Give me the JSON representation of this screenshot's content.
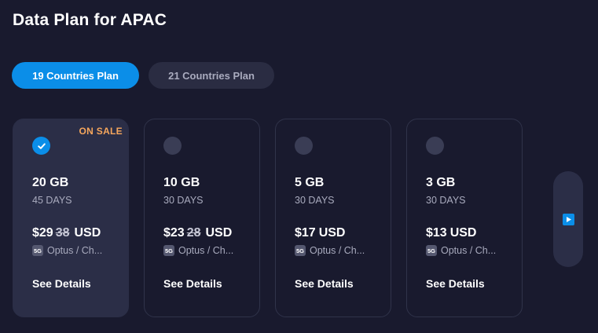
{
  "header": {
    "title": "Data Plan for APAC"
  },
  "tabs": [
    {
      "label": "19 Countries Plan",
      "active": true
    },
    {
      "label": "21 Countries Plan",
      "active": false
    }
  ],
  "plans": [
    {
      "selected": true,
      "badge": "ON SALE",
      "size": "20 GB",
      "days": "45 DAYS",
      "price": "$29",
      "old_price": "38",
      "currency": "USD",
      "network_badge": "5G",
      "network": "Optus / Ch...",
      "details_label": "See Details"
    },
    {
      "selected": false,
      "size": "10 GB",
      "days": "30 DAYS",
      "price": "$23",
      "old_price": "28",
      "currency": "USD",
      "network_badge": "5G",
      "network": "Optus / Ch...",
      "details_label": "See Details"
    },
    {
      "selected": false,
      "size": "5 GB",
      "days": "30 DAYS",
      "price": "$17",
      "currency": "USD",
      "network_badge": "5G",
      "network": "Optus / Ch...",
      "details_label": "See Details"
    },
    {
      "selected": false,
      "size": "3 GB",
      "days": "30 DAYS",
      "price": "$13",
      "currency": "USD",
      "network_badge": "5G",
      "network": "Optus / Ch...",
      "details_label": "See Details"
    }
  ],
  "icons": {
    "check": "check-icon",
    "next": "play-next-icon"
  },
  "colors": {
    "accent": "#0b8ee8",
    "sale": "#f6a65c",
    "background": "#191a2e",
    "card_selected": "#2b2e47"
  }
}
